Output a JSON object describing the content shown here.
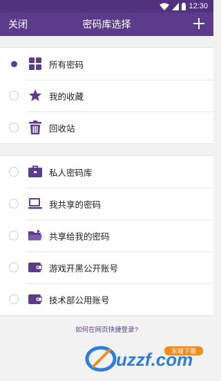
{
  "status": {
    "time": "12:30"
  },
  "header": {
    "close_label": "关闭",
    "title": "密码库选择"
  },
  "group1": [
    {
      "label": "所有密码",
      "icon": "grid-icon",
      "selected": true
    },
    {
      "label": "我的收藏",
      "icon": "star-icon",
      "selected": false
    },
    {
      "label": "回收站",
      "icon": "trash-icon",
      "selected": false
    }
  ],
  "group2": [
    {
      "label": "私人密码库",
      "icon": "briefcase-icon",
      "selected": false
    },
    {
      "label": "我共享的密码",
      "icon": "laptop-icon",
      "selected": false
    },
    {
      "label": "共享给我的密码",
      "icon": "folder-icon",
      "selected": false
    },
    {
      "label": "游戏开黑公开账号",
      "icon": "wallet-icon",
      "selected": false
    },
    {
      "label": "技术部公用账号",
      "icon": "wallet-icon",
      "selected": false
    }
  ],
  "help_link": "如何在网页快捷登录?",
  "watermark": {
    "site": "uzzf.com",
    "tag": "东坡下载"
  },
  "colors": {
    "primary": "#5c3b8d",
    "status_bar": "#50327f",
    "watermark_blue": "#2b7fd8",
    "watermark_orange": "#f08c1e"
  }
}
